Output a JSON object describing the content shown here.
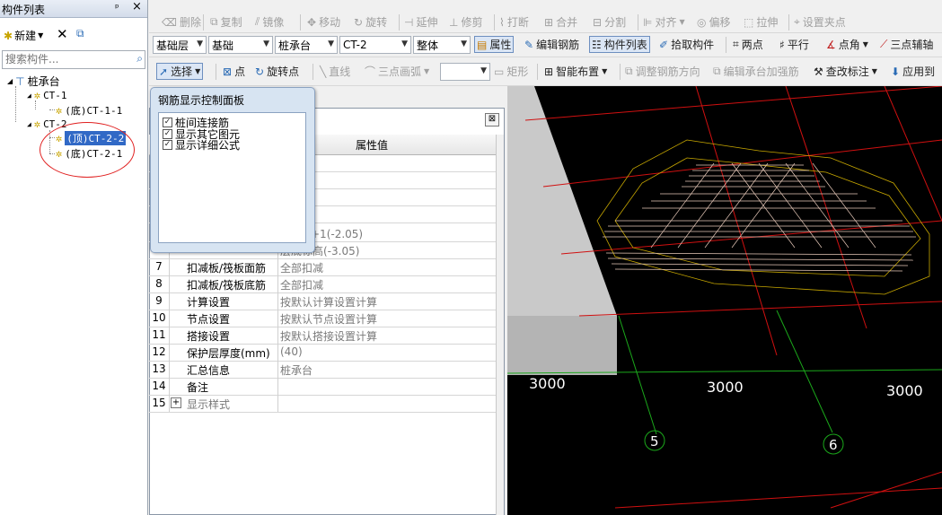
{
  "left_panel": {
    "title": "构件列表",
    "pin": "ᵖ",
    "close": "×",
    "new_label": "新建",
    "search_placeholder": "搜索构件...",
    "tree": {
      "root": "桩承台",
      "groups": [
        {
          "label": "CT-1",
          "children": [
            "(底)CT-1-1"
          ]
        },
        {
          "label": "CT-2",
          "children": [
            "(顶)CT-2-2",
            "(底)CT-2-1"
          ]
        }
      ]
    }
  },
  "toolbar1": {
    "delete": "删除",
    "copy": "复制",
    "mirror": "镜像",
    "move": "移动",
    "rotate": "旋转",
    "extend": "延伸",
    "trim": "修剪",
    "break": "打断",
    "merge": "合并",
    "split": "分割",
    "align": "对齐",
    "offset": "偏移",
    "stretch": "拉伸",
    "grip": "设置夹点"
  },
  "toolbar2": {
    "floor": "基础层",
    "type": "基础",
    "category": "桩承台",
    "component": "CT-2",
    "scope": "整体",
    "properties": "属性",
    "edit_rebar": "编辑钢筋",
    "component_list": "构件列表",
    "pick": "拾取构件",
    "two_point": "两点",
    "parallel": "平行",
    "point_angle": "点角",
    "three_point_axis": "三点辅轴"
  },
  "toolbar3": {
    "select": "选择",
    "point": "点",
    "rotate_point": "旋转点",
    "line": "直线",
    "arc": "三点画弧",
    "rect": "矩形",
    "smart_layout": "智能布置",
    "adjust_rebar_dir": "调整钢筋方向",
    "edit_cap_rebar": "编辑承台加强筋",
    "annotate": "查改标注",
    "apply_to": "应用到"
  },
  "property_grid": {
    "header_value": "属性值",
    "rows": [
      {
        "num": "",
        "name": "",
        "value": "高+1(-2.05)"
      },
      {
        "num": "",
        "name": "",
        "value": "层底标高(-3.05)"
      },
      {
        "num": "7",
        "name": "扣减板/筏板面筋",
        "value": "全部扣减"
      },
      {
        "num": "8",
        "name": "扣减板/筏板底筋",
        "value": "全部扣减"
      },
      {
        "num": "9",
        "name": "计算设置",
        "value": "按默认计算设置计算"
      },
      {
        "num": "10",
        "name": "节点设置",
        "value": "按默认节点设置计算"
      },
      {
        "num": "11",
        "name": "搭接设置",
        "value": "按默认搭接设置计算"
      },
      {
        "num": "12",
        "name": "保护层厚度(mm)",
        "value": "(40)"
      },
      {
        "num": "13",
        "name": "汇总信息",
        "value": "桩承台"
      },
      {
        "num": "14",
        "name": "备注",
        "value": ""
      },
      {
        "num": "15",
        "name": "显示样式",
        "value": ""
      }
    ]
  },
  "control_panel": {
    "title": "钢筋显示控制面板",
    "options": [
      {
        "label": "桩间连接筋",
        "checked": true
      },
      {
        "label": "显示其它图元",
        "checked": true
      },
      {
        "label": "显示详细公式",
        "checked": true
      }
    ]
  },
  "viewport": {
    "dims": [
      "3000",
      "3000",
      "3000"
    ],
    "axis_labels": [
      "5",
      "6"
    ]
  }
}
